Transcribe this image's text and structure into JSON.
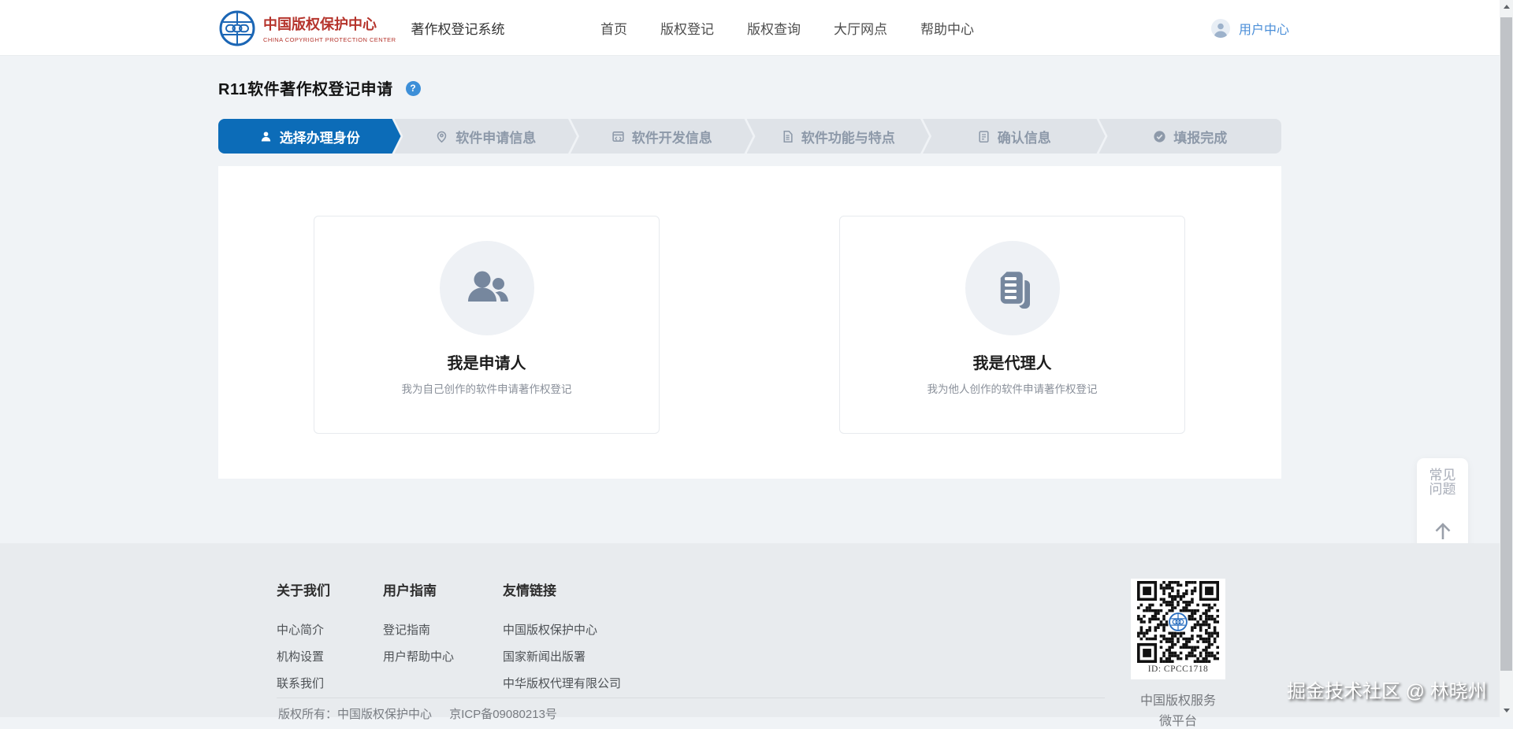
{
  "brand": {
    "name_cn": "中国版权保护中心",
    "name_en": "CHINA COPYRIGHT PROTECTION CENTER",
    "system": "著作权登记系统"
  },
  "nav": {
    "links": [
      "首页",
      "版权登记",
      "版权查询",
      "大厅网点",
      "帮助中心"
    ]
  },
  "user": {
    "label": "用户中心"
  },
  "page": {
    "title": "R11软件著作权登记申请"
  },
  "steps": [
    {
      "label": "选择办理身份",
      "icon": "user-icon",
      "active": true
    },
    {
      "label": "软件申请信息",
      "icon": "pin-icon",
      "active": false
    },
    {
      "label": "软件开发信息",
      "icon": "code-icon",
      "active": false
    },
    {
      "label": "软件功能与特点",
      "icon": "doc-icon",
      "active": false
    },
    {
      "label": "确认信息",
      "icon": "clipboard-icon",
      "active": false
    },
    {
      "label": "填报完成",
      "icon": "check-icon",
      "active": false
    }
  ],
  "cards": [
    {
      "title": "我是申请人",
      "desc": "我为自己创作的软件申请著作权登记",
      "icon": "users-icon"
    },
    {
      "title": "我是代理人",
      "desc": "我为他人创作的软件申请著作权登记",
      "icon": "document-icon"
    }
  ],
  "float": {
    "faq": "常见问题",
    "top_icon": "arrow-up"
  },
  "footer": {
    "columns": [
      {
        "title": "关于我们",
        "links": [
          "中心简介",
          "机构设置",
          "联系我们"
        ]
      },
      {
        "title": "用户指南",
        "links": [
          "登记指南",
          "用户帮助中心"
        ]
      },
      {
        "title": "友情链接",
        "links": [
          "中国版权保护中心",
          "国家新闻出版署",
          "中华版权代理有限公司"
        ]
      }
    ],
    "qr": {
      "id": "ID: CPCC1718",
      "caption1": "中国版权服务",
      "caption2": "微平台"
    },
    "copyright": "版权所有：中国版权保护中心",
    "icp": "京ICP备09080213号"
  },
  "watermark": "掘金技术社区 @ 林晓州",
  "colors": {
    "accent": "#0c6cb8",
    "brand_red": "#b5342c",
    "link_blue": "#4a8ed8"
  }
}
